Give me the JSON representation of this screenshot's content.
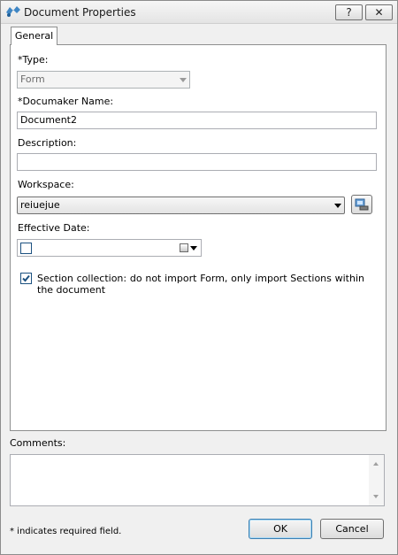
{
  "window": {
    "title": "Document Properties",
    "help_label": "?",
    "close_label": "✕"
  },
  "tabs": [
    {
      "label": "General",
      "active": true
    }
  ],
  "form": {
    "type_label": "*Type:",
    "type_value": "Form",
    "docname_label": "*Documaker Name:",
    "docname_value": "Document2",
    "description_label": "Description:",
    "description_value": "",
    "workspace_label": "Workspace:",
    "workspace_value": "reiuejue",
    "effective_date_label": "Effective Date:",
    "effective_date_checked": false,
    "section_collection_checked": true,
    "section_collection_text": "Section collection: do not import Form, only import Sections within the document"
  },
  "comments": {
    "label": "Comments:",
    "value": ""
  },
  "footer": {
    "required_note": "* indicates required field.",
    "ok_label": "OK",
    "cancel_label": "Cancel"
  },
  "colors": {
    "accent": "#1c5180",
    "window_bg": "#f0f0f0",
    "panel_bg": "#ffffff"
  },
  "icons": {
    "app": "documaker-app-icon",
    "workspace_button": "workspace-browse-icon",
    "calendar": "calendar-dropdown-icon",
    "checkmark": "checkmark-icon"
  }
}
